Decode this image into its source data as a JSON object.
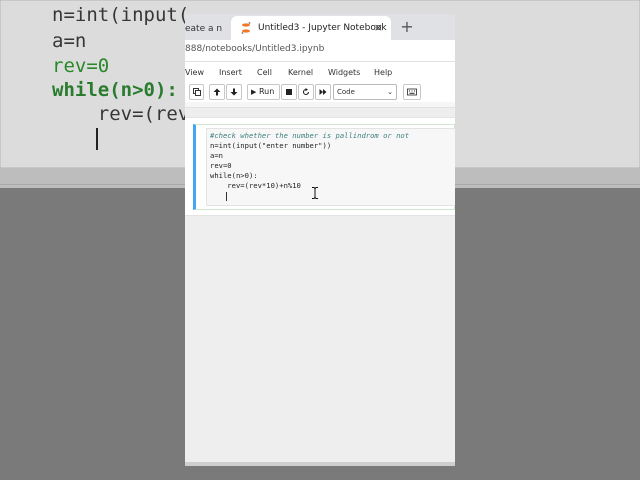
{
  "background": {
    "code_lines": [
      "n=int(input(",
      "a=n",
      "rev=0",
      "while(n>0):",
      "    rev=(rev"
    ]
  },
  "browser": {
    "tab_previous": "eate a n",
    "tab_previous_close": "×",
    "tab_active_title": "Untitled3 - Jupyter Notebook",
    "tab_active_close": "×",
    "new_tab": "+",
    "url": "888/notebooks/Untitled3.ipynb"
  },
  "menu": {
    "items": [
      "View",
      "Insert",
      "Cell",
      "Kernel",
      "Widgets",
      "Help"
    ]
  },
  "toolbar": {
    "run_label": "Run",
    "cell_type": "Code",
    "cell_type_chevron": "⌄"
  },
  "cell": {
    "lines": [
      "#check whether the number is pallindrom or not",
      "n=int(input(\"enter number\"))",
      "a=n",
      "rev=0",
      "while(n>0):",
      "    rev=(rev*10)+n%10"
    ]
  },
  "colors": {
    "accent": "#42a5f5",
    "comment": "#408080",
    "keyword": "#008000"
  }
}
